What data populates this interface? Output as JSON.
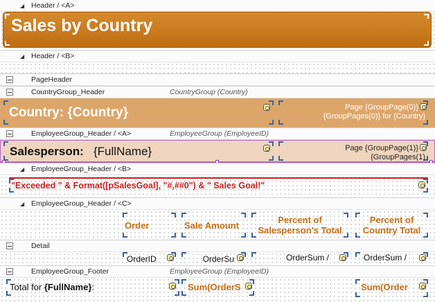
{
  "bands": {
    "header_a": "Header / <A>",
    "header_b": "Header / <B>",
    "page_header": "PageHeader",
    "country_group_header": "CountryGroup_Header",
    "country_group_info": "CountryGroup (Country)",
    "employee_group_header_a": "EmployeeGroup_Header / <A>",
    "employee_group_info_a": "EmployeeGroup (EmployeeID)",
    "employee_group_header_b": "EmployeeGroup_Header / <B>",
    "employee_group_header_c": "EmployeeGroup_Header / <C>",
    "detail": "Detail",
    "employee_group_footer": "EmployeeGroup_Footer",
    "employee_group_info_footer": "EmployeeGroup (EmployeeID)"
  },
  "report_title": "Sales by Country",
  "country": {
    "label": "Country: {Country}",
    "page_line1": "Page {GroupPage(0)}",
    "page_line2": "{GroupPages(0)} for  {Country}"
  },
  "salesperson": {
    "label": "Salesperson:",
    "value": " {FullName}",
    "page_line1": "Page {GroupPage(1)}",
    "page_line2": "{GroupPages(1)"
  },
  "goal_expression": "\"Exceeded \" & Format([pSalesGoal], \"#,##0\") & \" Sales Goal!\"",
  "columns": {
    "order": "Order",
    "sale_amount": "Sale Amount",
    "pct_sp_1": "Percent of",
    "pct_sp_2": "Salesperson's Total",
    "pct_c_1": "Percent of",
    "pct_c_2": "Country Total"
  },
  "detail": {
    "order_id": "OrderID",
    "order_sum": "OrderSu",
    "pct1": "OrderSum /",
    "pct2": "OrderSum /"
  },
  "footer": {
    "total_prefix": "Total for ",
    "total_field": "{FullName}",
    "total_suffix": ":",
    "sum1": "Sum(OrderS",
    "sum2": "Sum(Order",
    "sum2b": "Sum..."
  },
  "colors": {
    "header_orange": "#c8761d",
    "country_tan": "#dca66a",
    "salesperson_pink": "#efd5bf",
    "text_orange": "#c86d12",
    "text_red": "#cc1f1f"
  }
}
